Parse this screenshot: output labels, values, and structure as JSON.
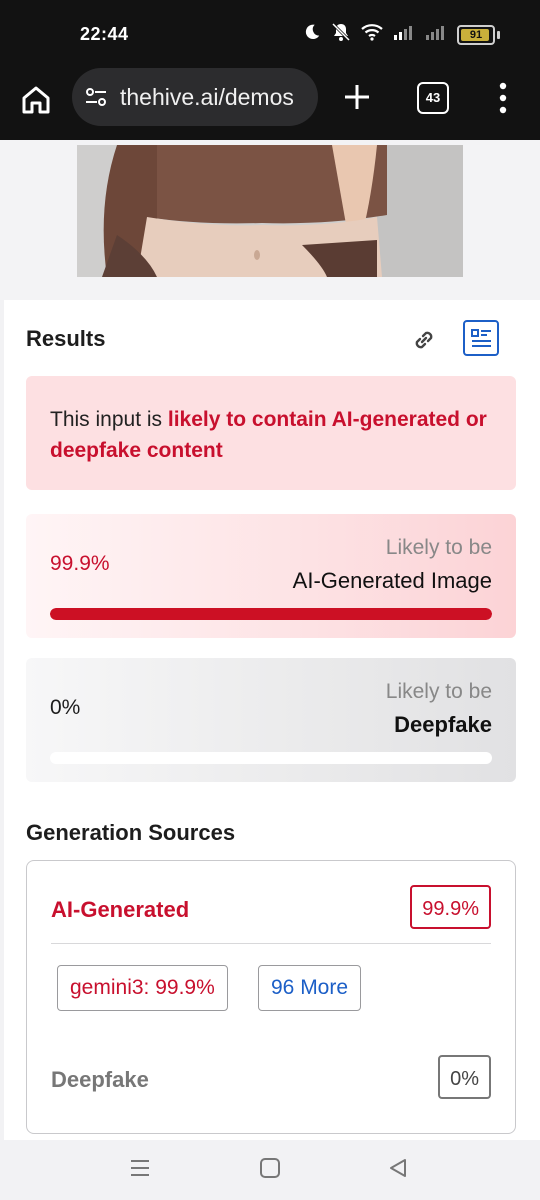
{
  "status_bar": {
    "time": "22:44",
    "battery": "91",
    "icons": [
      "moon-icon",
      "bell-muted-icon",
      "wifi-icon",
      "signal-icon",
      "signal-icon",
      "battery-icon"
    ]
  },
  "browser": {
    "url": "thehive.ai/demos",
    "tab_count": "43"
  },
  "results": {
    "title": "Results",
    "alert_prefix": "This input is ",
    "alert_highlight": "likely to contain AI-generated or deepfake content",
    "scores": [
      {
        "pct": "99.9%",
        "sub": "Likely to be",
        "label": "AI-Generated Image",
        "fill": 0.999
      },
      {
        "pct": "0%",
        "sub": "Likely to be",
        "label": "Deepfake",
        "fill": 0
      }
    ]
  },
  "generation_sources": {
    "title": "Generation Sources",
    "ai_label": "AI-Generated",
    "ai_value": "99.9%",
    "chip_model": "gemini3: 99.9%",
    "chip_more": "96 More",
    "deepfake_label": "Deepfake",
    "deepfake_value": "0%"
  },
  "colors": {
    "accent_red": "#c8102e",
    "link_blue": "#1c5fc7"
  }
}
